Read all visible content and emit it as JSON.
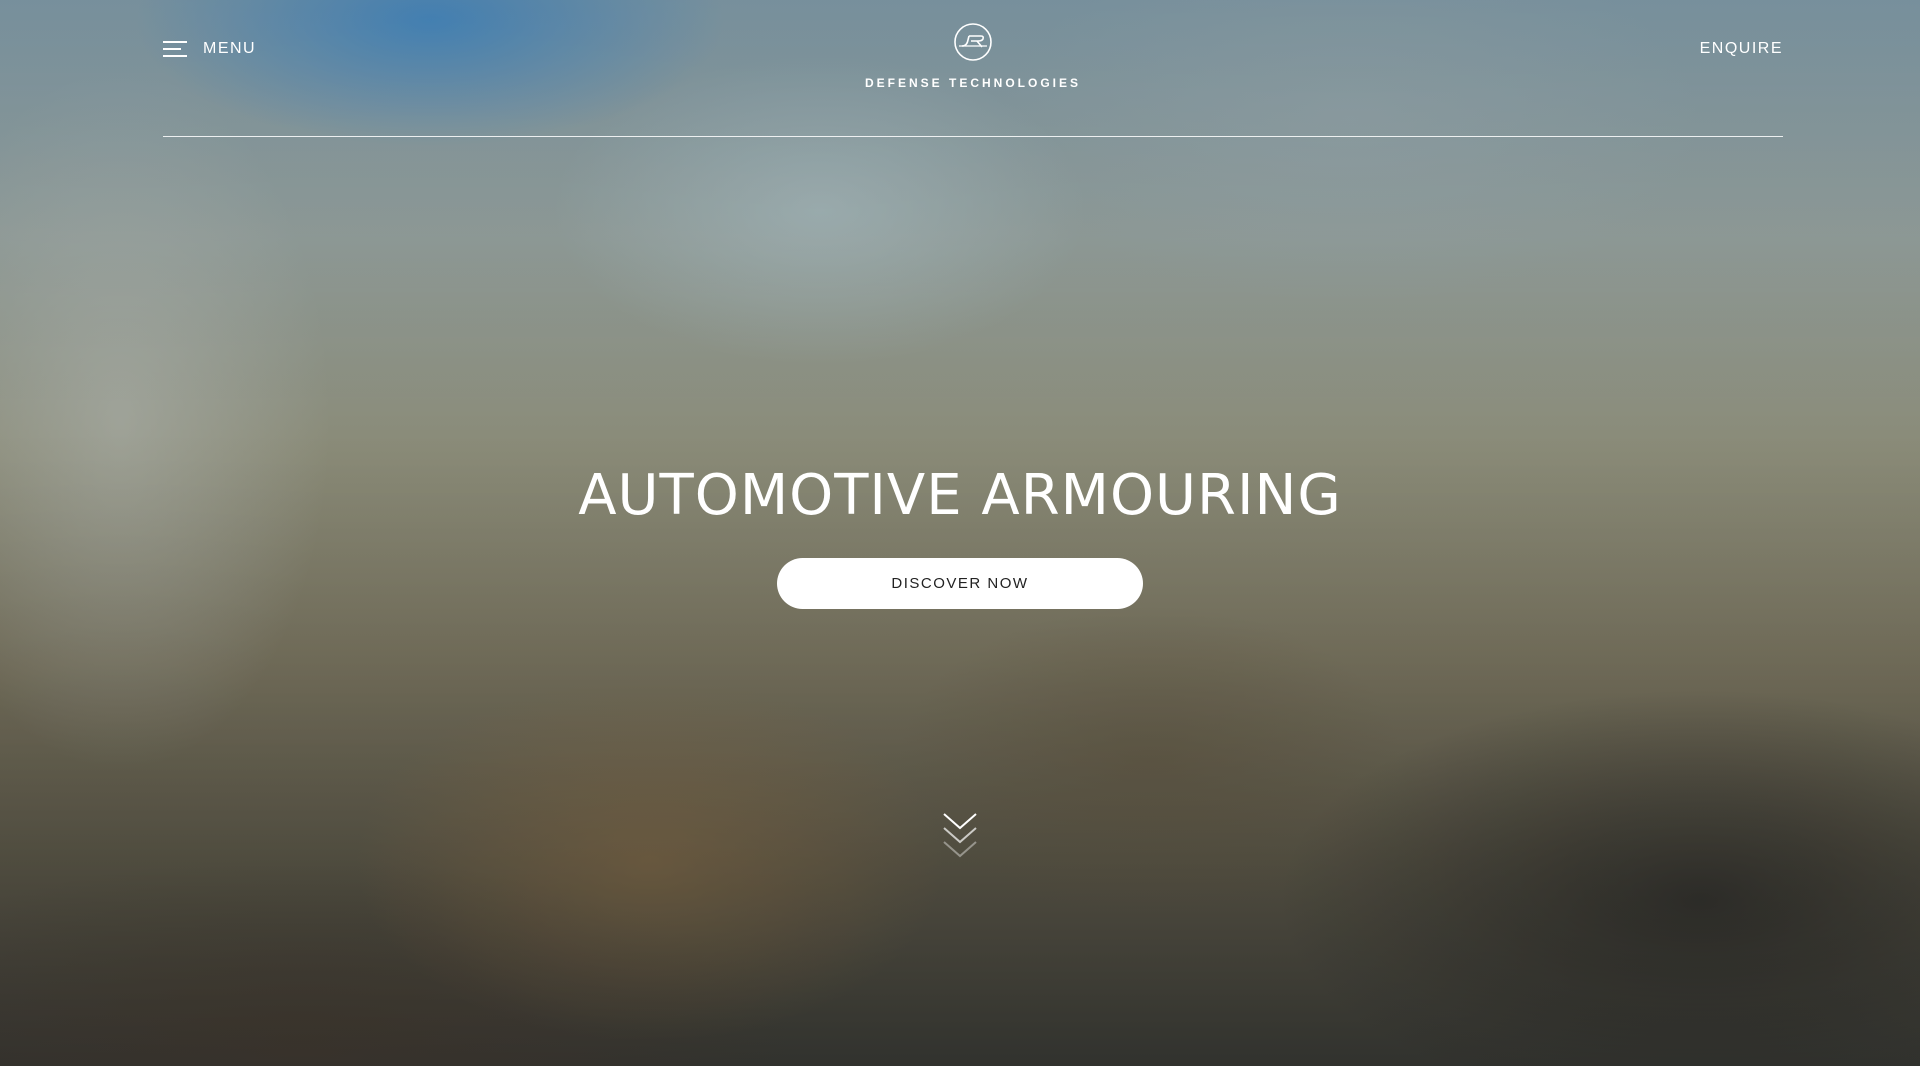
{
  "header": {
    "menu_label": "MENU",
    "brand_name": "DEFENSE TECHNOLOGIES",
    "enquire_label": "ENQUIRE"
  },
  "hero": {
    "title": "AUTOMOTIVE ARMOURING",
    "cta_label": "DISCOVER NOW"
  },
  "icons": {
    "menu": "hamburger-icon",
    "logo": "jr-logo-icon",
    "scroll": "chevrons-down-icon"
  },
  "colors": {
    "text": "#ffffff",
    "button_bg": "#ffffff",
    "button_text": "#222222"
  }
}
